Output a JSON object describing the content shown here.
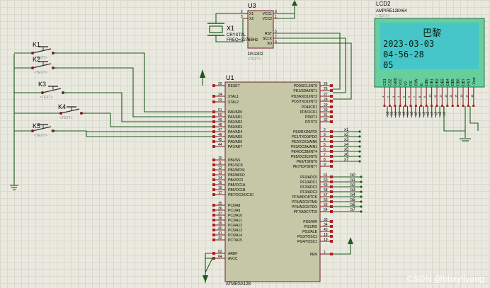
{
  "u1": {
    "ref": "U1",
    "part": "ATMEGA128",
    "text": "<TEXT>",
    "left_pins": [
      {
        "n": "20",
        "name": "RESET"
      },
      {
        "n": "24",
        "name": "XTAL1"
      },
      {
        "n": "23",
        "name": "XTAL2"
      },
      {
        "n": "51",
        "name": "PA0/AD0"
      },
      {
        "n": "50",
        "name": "PA1/AD1"
      },
      {
        "n": "49",
        "name": "PA2/AD2"
      },
      {
        "n": "48",
        "name": "PA3/AD3"
      },
      {
        "n": "47",
        "name": "PA4/AD4"
      },
      {
        "n": "46",
        "name": "PA5/AD5"
      },
      {
        "n": "45",
        "name": "PA6/AD6"
      },
      {
        "n": "44",
        "name": "PA7/AD7"
      },
      {
        "n": "10",
        "name": "PB0/SS"
      },
      {
        "n": "11",
        "name": "PB1/SCK"
      },
      {
        "n": "12",
        "name": "PB2/MOSI"
      },
      {
        "n": "13",
        "name": "PB3/MISO"
      },
      {
        "n": "14",
        "name": "PB4/OC0"
      },
      {
        "n": "15",
        "name": "PB5/OC1A"
      },
      {
        "n": "16",
        "name": "PB6/OC1B"
      },
      {
        "n": "17",
        "name": "PB7/OC2/OC1C"
      },
      {
        "n": "35",
        "name": "PC0/A8"
      },
      {
        "n": "36",
        "name": "PC1/A9"
      },
      {
        "n": "37",
        "name": "PC2/A10"
      },
      {
        "n": "38",
        "name": "PC3/A11"
      },
      {
        "n": "39",
        "name": "PC4/A12"
      },
      {
        "n": "40",
        "name": "PC5/A13"
      },
      {
        "n": "41",
        "name": "PC6/A14"
      },
      {
        "n": "42",
        "name": "PC7/A15"
      },
      {
        "n": "62",
        "name": "AREF"
      },
      {
        "n": "64",
        "name": "AVCC"
      }
    ],
    "right_pins": [
      {
        "n": "25",
        "name": "PD0/SCL/INT0"
      },
      {
        "n": "26",
        "name": "PD1/SDA/INT1"
      },
      {
        "n": "27",
        "name": "PD2/RXD1/INT2"
      },
      {
        "n": "28",
        "name": "PD3/TXD1/INT3"
      },
      {
        "n": "29",
        "name": "PD4/ICP1"
      },
      {
        "n": "30",
        "name": "PD5/XCK1"
      },
      {
        "n": "31",
        "name": "PD6/T1"
      },
      {
        "n": "32",
        "name": "PD7/T2"
      },
      {
        "n": "2",
        "name": "PE0/RXD0/PDI"
      },
      {
        "n": "3",
        "name": "PE1/TXD0/PDO"
      },
      {
        "n": "4",
        "name": "PE2/XCK0/AIN0"
      },
      {
        "n": "5",
        "name": "PE3/OC3A/AIN1"
      },
      {
        "n": "6",
        "name": "PE4/OC3B/INT4"
      },
      {
        "n": "7",
        "name": "PE5/OC3C/INT5"
      },
      {
        "n": "8",
        "name": "PE6/T3/INT6"
      },
      {
        "n": "9",
        "name": "PE7/ICP3/INT7"
      },
      {
        "n": "61",
        "name": "PF0/ADC0"
      },
      {
        "n": "60",
        "name": "PF1/ADC1"
      },
      {
        "n": "59",
        "name": "PF2/ADC2"
      },
      {
        "n": "58",
        "name": "PF3/ADC3"
      },
      {
        "n": "57",
        "name": "PF4/ADC4/TCK"
      },
      {
        "n": "56",
        "name": "PF5/ADC5/TMS"
      },
      {
        "n": "55",
        "name": "PF6/ADC6/TDO"
      },
      {
        "n": "54",
        "name": "PF7/ADC7/TDI"
      },
      {
        "n": "33",
        "name": "PG0/WR"
      },
      {
        "n": "34",
        "name": "PG1/RD"
      },
      {
        "n": "43",
        "name": "PG2/ALE"
      },
      {
        "n": "18",
        "name": "PG3/TOSC2"
      },
      {
        "n": "19",
        "name": "PG4/TOSC1"
      },
      {
        "n": "1",
        "name": "PEN"
      }
    ]
  },
  "pe_nets": [
    "x1",
    "x2",
    "x3",
    "x4",
    "x5",
    "x6",
    "x7"
  ],
  "pf_nets": [
    "b0",
    "b1",
    "b2",
    "b3",
    "b4",
    "b5",
    "b6",
    "b7"
  ],
  "u3": {
    "ref": "U3",
    "part": "DS1302",
    "text": "<TEXT>",
    "left_pins": [
      {
        "n": "2",
        "name": "X1"
      },
      {
        "n": "3",
        "name": "X2"
      }
    ],
    "right_pins": [
      {
        "n": "8",
        "name": "VCC1"
      },
      {
        "n": "1",
        "name": "VCC2"
      },
      {
        "n": "5",
        "name": "RST"
      },
      {
        "n": "7",
        "name": "SCLK"
      },
      {
        "n": "6",
        "name": "I/O"
      }
    ]
  },
  "x1": {
    "ref": "X1",
    "type": "CRYSTAL",
    "freq": "FREQ=32768Hz"
  },
  "keys": [
    {
      "ref": "K1",
      "text": "<TEXT>"
    },
    {
      "ref": "K2",
      "text": "<TEXT>"
    },
    {
      "ref": "K3",
      "text": "<TEXT>"
    },
    {
      "ref": "K4",
      "text": "<TEXT>"
    },
    {
      "ref": "K5",
      "text": "<TEXT>"
    }
  ],
  "lcd": {
    "ref": "LCD2",
    "part": "AMPIRE128X64",
    "text": "<TEXT>",
    "lines": [
      "巴黎",
      "2023-03-03",
      "04-56-28",
      "05"
    ],
    "pins": [
      "CS1",
      "CS2",
      "GND",
      "VCC",
      "V0",
      "RS",
      "R/W",
      "E",
      "DB0",
      "DB1",
      "DB2",
      "DB3",
      "DB4",
      "DB5",
      "DB6",
      "DB7",
      "RST",
      "-Vout"
    ],
    "pin_nums": [
      "1",
      "2",
      "3",
      "4",
      "5",
      "6",
      "7",
      "8",
      "9",
      "10",
      "11",
      "12",
      "13",
      "14",
      "15",
      "16",
      "17",
      "18"
    ],
    "bus_labels": [
      "b0",
      "b1",
      "b2",
      "b3",
      "b4",
      "b5",
      "b6",
      "b7",
      "x7",
      "x6",
      "x5",
      "x4",
      "x3",
      "x2",
      "x1"
    ],
    "colors": {
      "bg": "#47c6c9",
      "frame": "#66cf9c",
      "text": "#0a1a0a"
    }
  },
  "watermark": "CSDN @bbxyllyang",
  "colors": {
    "canvas": "#e9e9df",
    "grid": "#d9d9cd",
    "wire": "#1d5a1d",
    "pin": "#7a1a1a",
    "chip": "#c6c7a6"
  }
}
